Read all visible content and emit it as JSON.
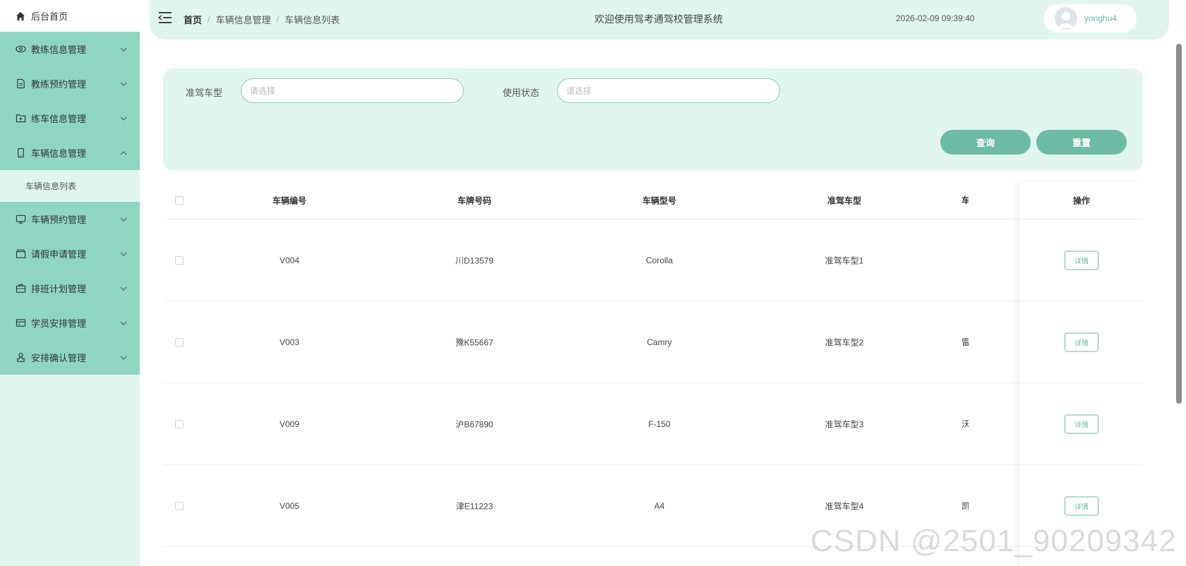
{
  "sidebar": {
    "home_label": "后台首页",
    "items": [
      {
        "label": "教练信息管理",
        "icon": "eye-icon",
        "expanded": false
      },
      {
        "label": "教练预约管理",
        "icon": "document-icon",
        "expanded": false
      },
      {
        "label": "练车信息管理",
        "icon": "folder-add-icon",
        "expanded": false
      },
      {
        "label": "车辆信息管理",
        "icon": "phone-icon",
        "expanded": true
      },
      {
        "label": "车辆预约管理",
        "icon": "monitor-icon",
        "expanded": false
      },
      {
        "label": "请假申请管理",
        "icon": "box-icon",
        "expanded": false
      },
      {
        "label": "排班计划管理",
        "icon": "briefcase-icon",
        "expanded": false
      },
      {
        "label": "学员安排管理",
        "icon": "credit-card-icon",
        "expanded": false
      },
      {
        "label": "安排确认管理",
        "icon": "stamp-icon",
        "expanded": false
      }
    ],
    "active_sub_label": "车辆信息列表"
  },
  "header": {
    "breadcrumb": [
      "首页",
      "车辆信息管理",
      "车辆信息列表"
    ],
    "title": "欢迎使用驾考通驾校管理系统",
    "datetime": "2026-02-09 09:39:40",
    "username": "yonghu4"
  },
  "search": {
    "field1_label": "准驾车型",
    "field1_placeholder": "请选择",
    "field2_label": "使用状态",
    "field2_placeholder": "请选择",
    "query_label": "查询",
    "reset_label": "重置"
  },
  "table": {
    "headers": [
      "车辆编号",
      "车牌号码",
      "车辆型号",
      "准驾车型",
      "车",
      "操作"
    ],
    "rows": [
      {
        "id": "V004",
        "plate": "川D13579",
        "model": "Corolla",
        "license": "准驾车型1",
        "partial": "",
        "action": "详情"
      },
      {
        "id": "V003",
        "plate": "豫K55667",
        "model": "Camry",
        "license": "准驾车型2",
        "partial": "雷",
        "action": "详情"
      },
      {
        "id": "V009",
        "plate": "沪B67890",
        "model": "F-150",
        "license": "准驾车型3",
        "partial": "沃",
        "action": "详情"
      },
      {
        "id": "V005",
        "plate": "津E11223",
        "model": "A4",
        "license": "准驾车型4",
        "partial": "凯",
        "action": "详情"
      }
    ]
  },
  "watermark": "CSDN @2501_90209342",
  "colors": {
    "sidebar_bg": "#e1f5ef",
    "sidebar_group_bg": "#8ed6c2",
    "accent": "#6dbaa5",
    "header_bg": "#e1f5ef"
  }
}
